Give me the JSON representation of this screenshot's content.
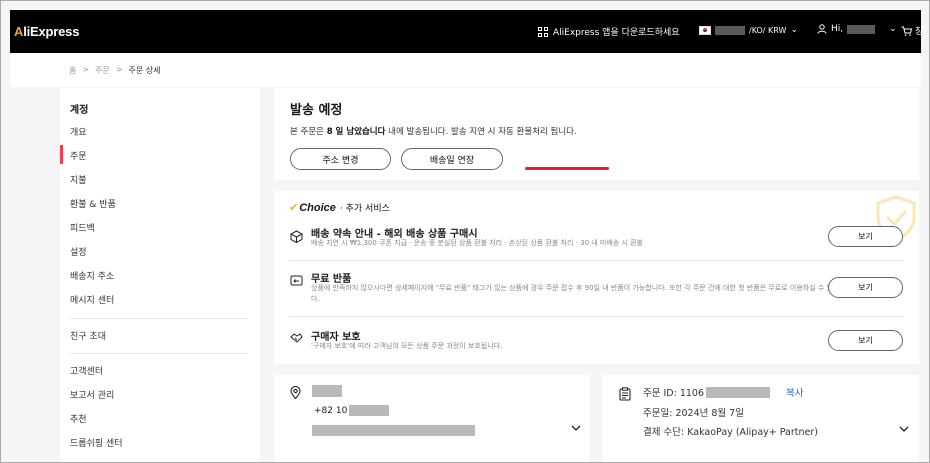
{
  "header": {
    "logo": "AliExpress",
    "download_text": "AliExpress 앱을 다운로드하세요",
    "region_text": "/KO/ KRW",
    "greeting": "Hi,",
    "cart_text": "장"
  },
  "breadcrumb": {
    "home": "홈",
    "sep1": ">",
    "orders": "주문",
    "sep2": ">",
    "current": "주문 상세"
  },
  "sidebar": {
    "title": "계정",
    "items": [
      {
        "label": "개요"
      },
      {
        "label": "주문"
      },
      {
        "label": "지불"
      },
      {
        "label": "환불 & 반품"
      },
      {
        "label": "피드백"
      },
      {
        "label": "설정"
      },
      {
        "label": "배송지 주소"
      },
      {
        "label": "메시지 센터"
      },
      {
        "label": "친구 초대"
      },
      {
        "label": "고객센터"
      },
      {
        "label": "보고서 관리"
      },
      {
        "label": "추천"
      },
      {
        "label": "드롭쉬핑 센터"
      }
    ]
  },
  "status_card": {
    "title": "발송 예정",
    "text_before": "본 주문은 ",
    "text_bold": "8 일 남았습니다",
    "text_after": " 내에 발송됩니다. 발송 지연 시 자동 환불처리 됩니다.",
    "change_address_button": "주소 변경",
    "extend_delivery_button": "배송일 연장"
  },
  "choice_card": {
    "brand": "Choice",
    "subtitle": "· 추가 서비스",
    "features": [
      {
        "title": "배송 약속 안내 - 해외 배송 상품 구매시",
        "desc": "배송 지연 시 ₩1,300 쿠폰 지급 · 운송 중 분실된 상품 환불 처리 · 손상된 상품 환불 처리 · 30 내 미배송 시 환불",
        "button": "보기"
      },
      {
        "title": "무료 반품",
        "desc": "상품에 만족하지 않으시다면 상세페이지에 \"무료 반품\" 태그가 있는 상품에 경우 주문 접수 후 90일 내 반품이 가능합니다. 또한 각 주문 건에 대한 첫 반품은 무료로 이용하실 수 있습니다.",
        "button": "보기"
      },
      {
        "title": "구매자 보호",
        "desc": "'구매자 보호'에 따라 고객님의 모든 상품 주문 과정이 보호됩니다.",
        "button": "보기"
      }
    ]
  },
  "address_card": {
    "phone_prefix": "+82 10"
  },
  "order_card": {
    "order_id_label": "주문 ID: 1106",
    "copy_label": "복사",
    "order_date": "주문일: 2024년 8월 7일",
    "payment": "결제 수단: KakaoPay (Alipay+ Partner)"
  },
  "colors": {
    "accent": "#fd384f",
    "red_underline": "#e0212c",
    "choice_yellow": "#ffad0d",
    "link_blue": "#1f6bd1"
  }
}
